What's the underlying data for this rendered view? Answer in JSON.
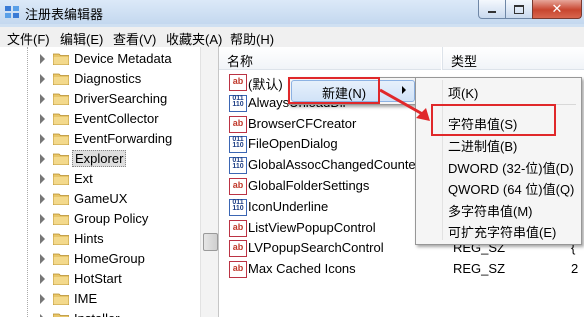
{
  "window": {
    "title": "注册表编辑器",
    "controls": {
      "minimize_icon": "minimize-icon",
      "maximize_icon": "maximize-icon",
      "close_icon": "close-icon"
    }
  },
  "menu": [
    "文件(F)",
    "编辑(E)",
    "查看(V)",
    "收藏夹(A)",
    "帮助(H)"
  ],
  "tree": {
    "items": [
      {
        "label": "Device Metadata",
        "selected": false
      },
      {
        "label": "Diagnostics",
        "selected": false
      },
      {
        "label": "DriverSearching",
        "selected": false
      },
      {
        "label": "EventCollector",
        "selected": false
      },
      {
        "label": "EventForwarding",
        "selected": false
      },
      {
        "label": "Explorer",
        "selected": true
      },
      {
        "label": "Ext",
        "selected": false
      },
      {
        "label": "GameUX",
        "selected": false
      },
      {
        "label": "Group Policy",
        "selected": false
      },
      {
        "label": "Hints",
        "selected": false
      },
      {
        "label": "HomeGroup",
        "selected": false
      },
      {
        "label": "HotStart",
        "selected": false
      },
      {
        "label": "IME",
        "selected": false
      },
      {
        "label": "Installer",
        "selected": false
      }
    ]
  },
  "list": {
    "headers": {
      "name": "名称",
      "type": "类型"
    },
    "rows": [
      {
        "icon": "ab",
        "name": "(默认)",
        "type": "",
        "data": ""
      },
      {
        "icon": "bin",
        "name": "AlwaysUnloadDll",
        "type": "",
        "data": ""
      },
      {
        "icon": "ab",
        "name": "BrowserCFCreator",
        "type": "",
        "data": ""
      },
      {
        "icon": "bin",
        "name": "FileOpenDialog",
        "type": "",
        "data": ""
      },
      {
        "icon": "bin",
        "name": "GlobalAssocChangedCounter",
        "type": "",
        "data": ""
      },
      {
        "icon": "ab",
        "name": "GlobalFolderSettings",
        "type": "",
        "data": ""
      },
      {
        "icon": "bin",
        "name": "IconUnderline",
        "type": "",
        "data": ""
      },
      {
        "icon": "ab",
        "name": "ListViewPopupControl",
        "type": "REG_SZ",
        "data": "{"
      },
      {
        "icon": "ab",
        "name": "LVPopupSearchControl",
        "type": "REG_SZ",
        "data": "{"
      },
      {
        "icon": "ab",
        "name": "Max Cached Icons",
        "type": "REG_SZ",
        "data": "2"
      }
    ]
  },
  "context_menu": {
    "new_label": "新建(N)",
    "submenu": [
      "项(K)",
      "字符串值(S)",
      "二进制值(B)",
      "DWORD (32-位)值(D)",
      "QWORD (64 位)值(Q)",
      "多字符串值(M)",
      "可扩充字符串值(E)"
    ]
  },
  "colors": {
    "highlight_box": "#e0282a",
    "titlebar": "#c4d8ef",
    "folder": "#e8c66a"
  }
}
